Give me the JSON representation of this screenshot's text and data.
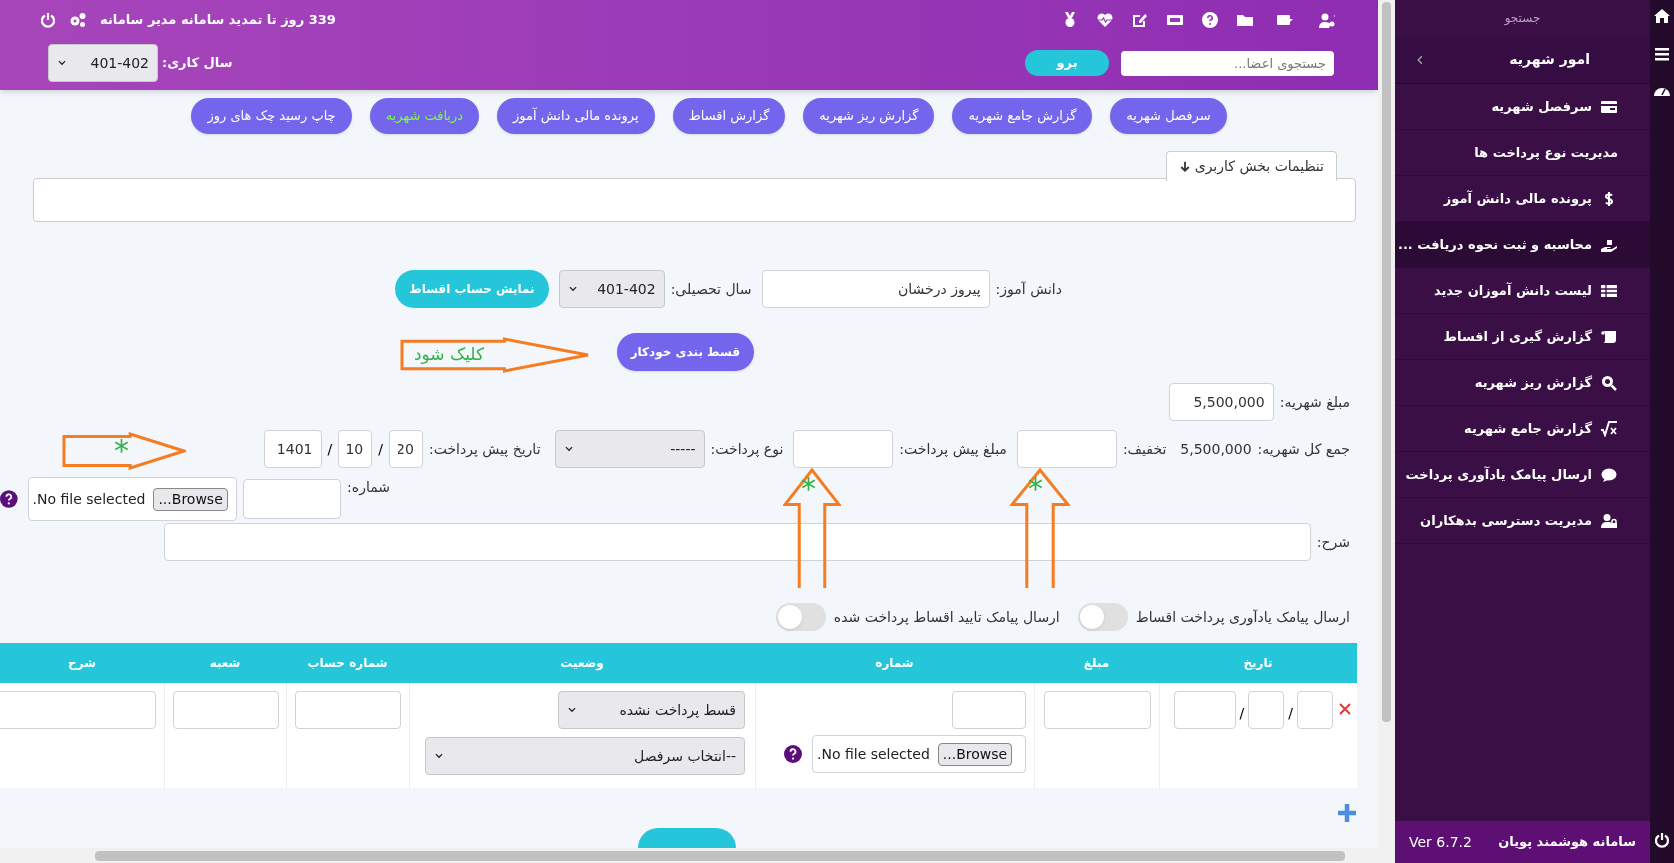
{
  "header": {
    "notice": "339 روز تا تمدید سامانه مدیر سامانه",
    "search": {
      "placeholder": "جستجوی اعضا..."
    },
    "go_button": "برو",
    "work_year": {
      "label": "سال کاری:",
      "value": "401-402"
    }
  },
  "tabs": [
    {
      "label": "سرفصل شهریه",
      "selected": false
    },
    {
      "label": "گزارش جامع شهریه",
      "selected": false
    },
    {
      "label": "گزارش ریز شهریه",
      "selected": false
    },
    {
      "label": "گزارش اقساط",
      "selected": false
    },
    {
      "label": "پرونده مالی دانش آموز",
      "selected": false
    },
    {
      "label": "دریافت شهریه",
      "selected": true
    },
    {
      "label": "چاپ رسید چک های روز",
      "selected": false
    }
  ],
  "settings_tab": "تنظیمات بخش کاربری",
  "student_row": {
    "student_label": "دانش آموز:",
    "student_value": "پیروز درخشان",
    "year_label": "سال تحصیلی:",
    "year_value": "401-402",
    "show_button": "نمایش حساب اقساط"
  },
  "auto_button": "قسط بندی خودکار",
  "tuition": {
    "label": "مبلغ شهریه:",
    "value": "5,500,000"
  },
  "payment_row": {
    "total_label": "جمع کل شهریه:",
    "total_value": "5,500,000",
    "discount_label": "تخفیف:",
    "prepay_label": "مبلغ پیش پرداخت:",
    "type_label": "نوع پرداخت:",
    "type_value": "-----",
    "date_label": "تاریخ پیش پرداخت:",
    "day": "20",
    "separator_1": "/",
    "month": "10",
    "separator_2": "/",
    "year": "1401"
  },
  "number_row": {
    "label": "شماره:",
    "file_button": "Browse...",
    "file_text": "No file selected."
  },
  "description_label": "شرح:",
  "toggles": [
    {
      "label": "ارسال پیامک یادآوری پرداخت اقساط",
      "on": false
    },
    {
      "label": "ارسال پیامک تایید اقساط پرداخت شده",
      "on": false
    }
  ],
  "table": {
    "columns": [
      "تاریخ",
      "مبلغ",
      "شماره",
      "وضعیت",
      "شماره حساب",
      "شعبه",
      "شرح"
    ],
    "rows": [
      {
        "date_separator_1": "/",
        "date_separator_2": "/",
        "file_button": "Browse...",
        "file_text": "No file selected.",
        "status": "قسط پرداخت نشده",
        "heading": "--انتخاب سرفصل"
      }
    ]
  },
  "annotations": [
    {
      "kind": "right-arrow",
      "text": "کلیک شود"
    },
    {
      "kind": "right-arrow",
      "text": "*"
    },
    {
      "kind": "up-arrow",
      "text": "*"
    },
    {
      "kind": "up-arrow",
      "text": "*"
    }
  ],
  "sidebar": {
    "search": "جستجو",
    "section": "امور شهریه",
    "items": [
      {
        "label": "سرفصل شهریه",
        "selected": false
      },
      {
        "label": "مدیریت نوع پرداخت ها",
        "selected": false
      },
      {
        "label": "پرونده مالی دانش آموز",
        "selected": false
      },
      {
        "label": "محاسبه و ثبت نحوه دریافت ...",
        "selected": true
      },
      {
        "label": "لیست دانش آموزان جدید",
        "selected": false
      },
      {
        "label": "گزارش گیری از اقساط",
        "selected": false
      },
      {
        "label": "گزارش ریز شهریه",
        "selected": false
      },
      {
        "label": "گزارش جامع شهریه",
        "selected": false
      },
      {
        "label": "ارسال پیامک یادآوری پرداخت",
        "selected": false
      },
      {
        "label": "مدیریت دسترسی بدهکاران",
        "selected": false
      }
    ],
    "footer_name": "سامانه هوشمند پویان",
    "footer_version": "Ver 6.7.2"
  }
}
